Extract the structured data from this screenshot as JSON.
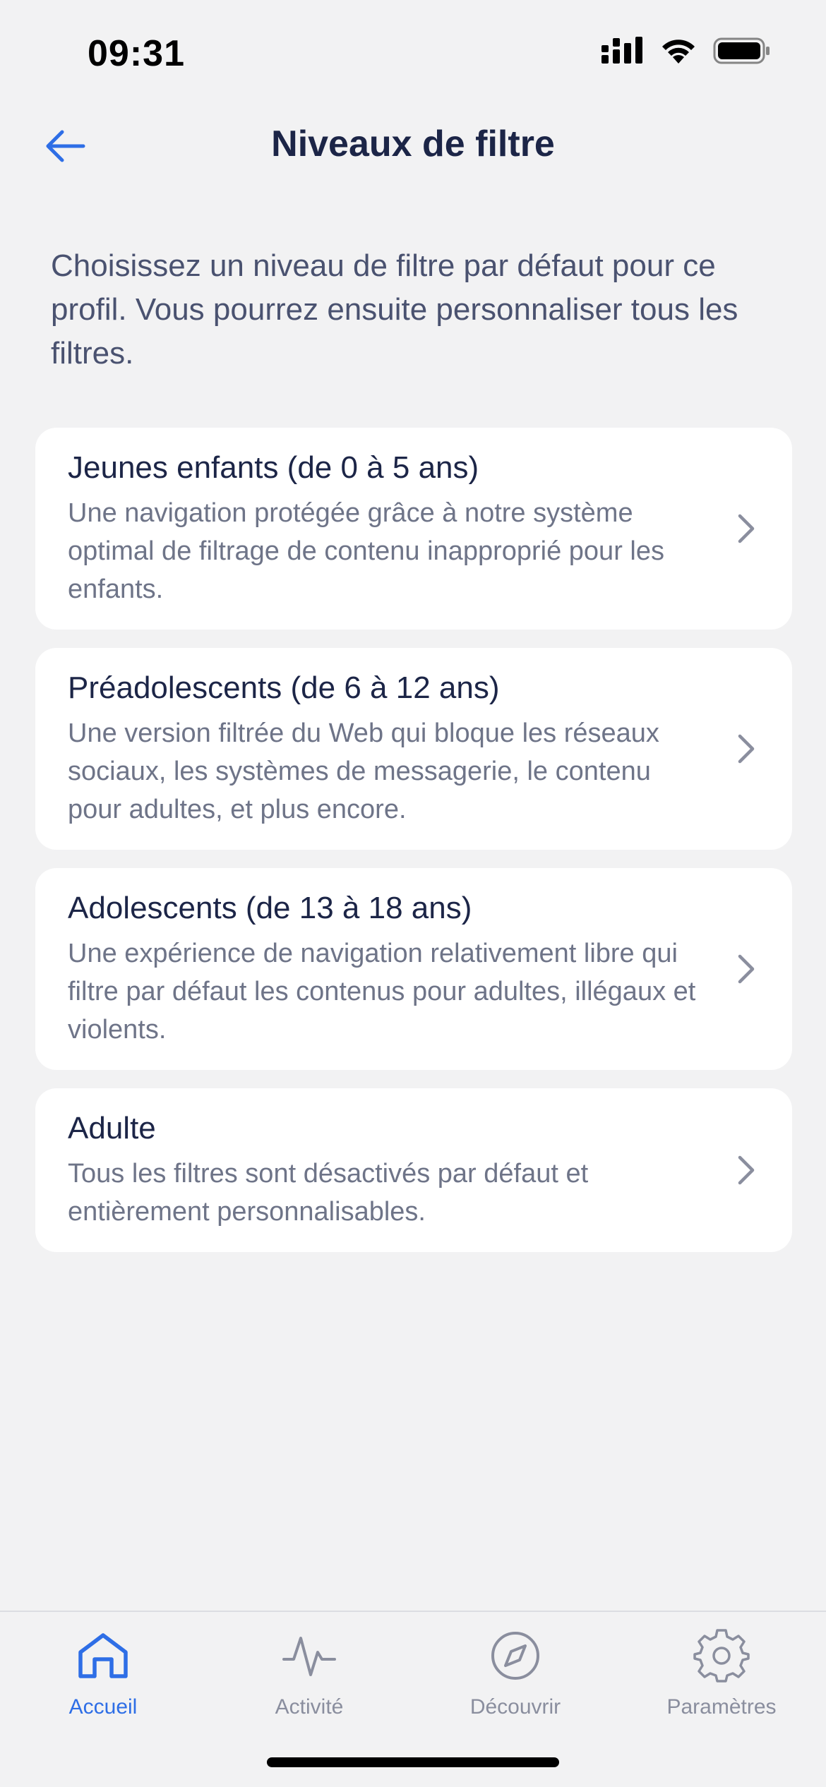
{
  "status_bar": {
    "time": "09:31"
  },
  "header": {
    "title": "Niveaux de filtre",
    "back_icon": "arrow-left-icon"
  },
  "intro": "Choisissez un niveau de filtre par défaut pour ce profil. Vous pourrez ensuite personnaliser tous les filtres.",
  "levels": [
    {
      "title": "Jeunes enfants (de 0 à 5 ans)",
      "description": "Une navigation protégée grâce à notre système optimal de filtrage de contenu inapproprié pour les enfants."
    },
    {
      "title": "Préadolescents (de 6 à 12 ans)",
      "description": "Une version filtrée du Web qui bloque les réseaux sociaux, les systèmes de messagerie, le contenu pour adultes, et plus encore."
    },
    {
      "title": "Adolescents (de 13 à 18 ans)",
      "description": "Une expérience de navigation relativement libre qui filtre par défaut les contenus pour adultes, illégaux et violents."
    },
    {
      "title": "Adulte",
      "description": "Tous les filtres sont désactivés par défaut et entièrement personnalisables."
    }
  ],
  "tabs": [
    {
      "label": "Accueil",
      "icon": "home-icon",
      "active": true
    },
    {
      "label": "Activité",
      "icon": "activity-icon",
      "active": false
    },
    {
      "label": "Découvrir",
      "icon": "compass-icon",
      "active": false
    },
    {
      "label": "Paramètres",
      "icon": "gear-icon",
      "active": false
    }
  ],
  "colors": {
    "accent": "#2e6ee6",
    "title": "#1c2547",
    "secondary_text": "#6e7488",
    "background": "#f2f2f3",
    "card": "#ffffff"
  }
}
